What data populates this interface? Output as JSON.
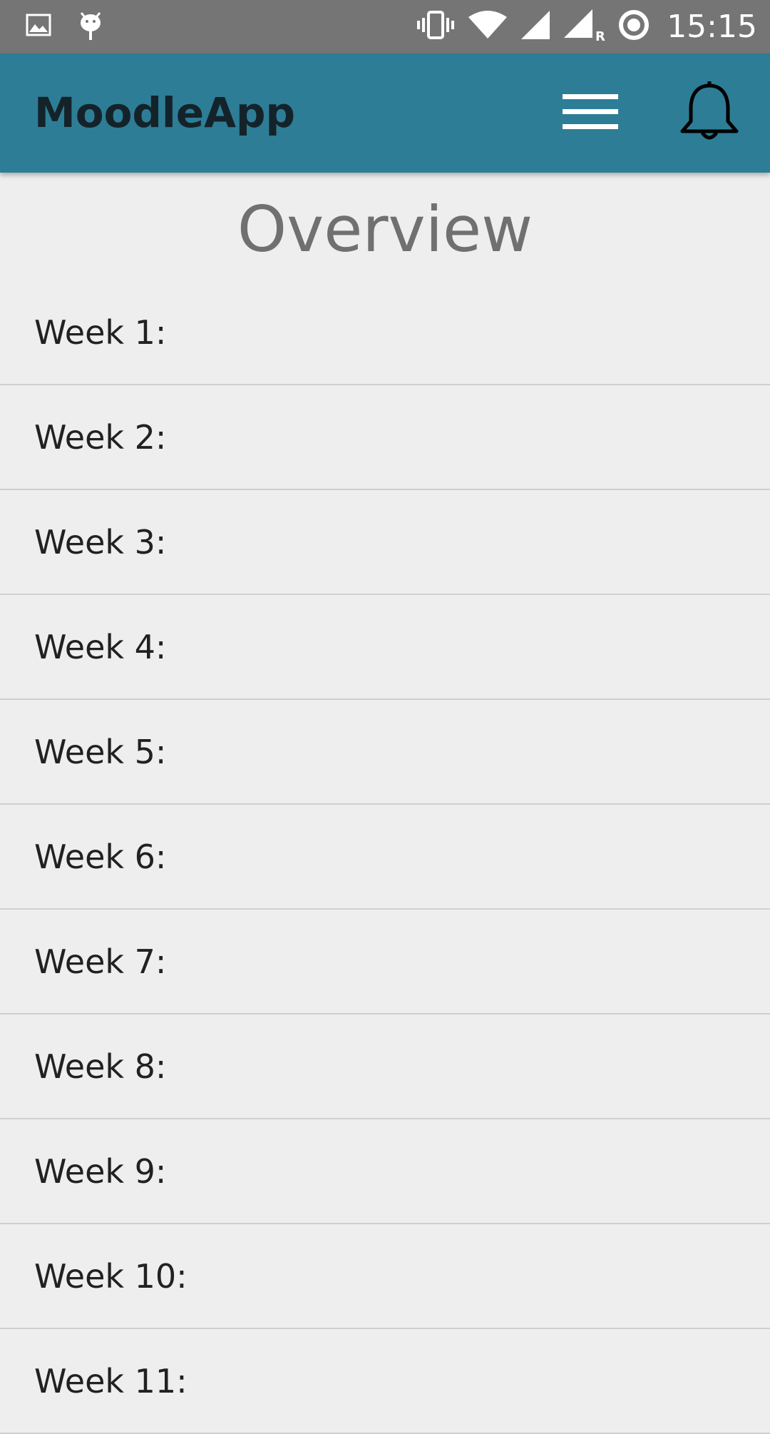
{
  "status_bar": {
    "time": "15:15",
    "left_icons": [
      "image-icon",
      "android-debug-icon"
    ],
    "right_icons": [
      "vibrate-icon",
      "wifi-icon",
      "signal-icon",
      "signal-roaming-icon",
      "sync-icon"
    ],
    "roaming_label": "R"
  },
  "app_bar": {
    "title": "MoodleApp",
    "background": "#2e7d96"
  },
  "page": {
    "title": "Overview"
  },
  "weeks": [
    {
      "label": "Week 1:"
    },
    {
      "label": "Week 2:"
    },
    {
      "label": "Week 3:"
    },
    {
      "label": "Week 4:"
    },
    {
      "label": "Week 5:"
    },
    {
      "label": "Week 6:"
    },
    {
      "label": "Week 7:"
    },
    {
      "label": "Week 8:"
    },
    {
      "label": "Week 9:"
    },
    {
      "label": "Week 10:"
    },
    {
      "label": "Week 11:"
    }
  ]
}
